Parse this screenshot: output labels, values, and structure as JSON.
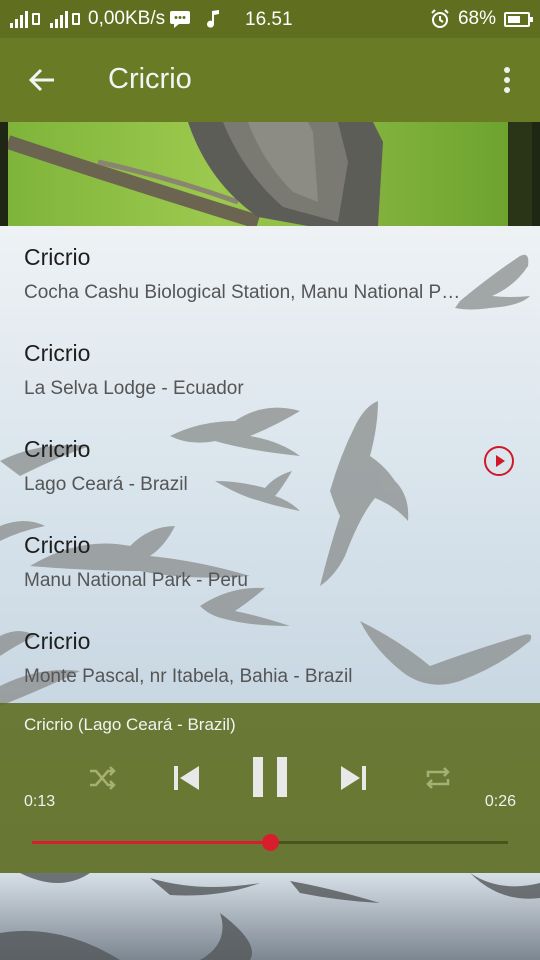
{
  "status_bar": {
    "network_speed": "0,00KB/s",
    "time": "16.51",
    "battery": "68%",
    "battery_level": 0.68,
    "icons": [
      "signal-icon",
      "sim-icon",
      "signal-icon",
      "sim-2-icon",
      "message-icon",
      "music-note-icon",
      "alarm-icon",
      "battery-icon"
    ]
  },
  "app_bar": {
    "title": "Cricrio",
    "icons": [
      "arrow-back-icon",
      "more-vert-icon"
    ]
  },
  "recordings": [
    {
      "title": "Cricrio",
      "location": "Cocha Cashu Biological Station, Manu National Park - Peru",
      "playing": false
    },
    {
      "title": "Cricrio",
      "location": "La Selva Lodge - Ecuador",
      "playing": false
    },
    {
      "title": "Cricrio",
      "location": "Lago Ceará - Brazil",
      "playing": true
    },
    {
      "title": "Cricrio",
      "location": "Manu National Park - Peru",
      "playing": false
    },
    {
      "title": "Cricrio",
      "location": "Monte Pascal, nr Itabela, Bahia - Brazil",
      "playing": false
    }
  ],
  "player": {
    "now_playing": "Cricrio (Lago Ceará - Brazil)",
    "current_time": "0:13",
    "duration": "0:26",
    "progress": 0.5,
    "accent_color": "#d81e2c",
    "controls": [
      "shuffle-icon",
      "skip-previous-icon",
      "pause-icon",
      "skip-next-icon",
      "repeat-icon"
    ]
  }
}
